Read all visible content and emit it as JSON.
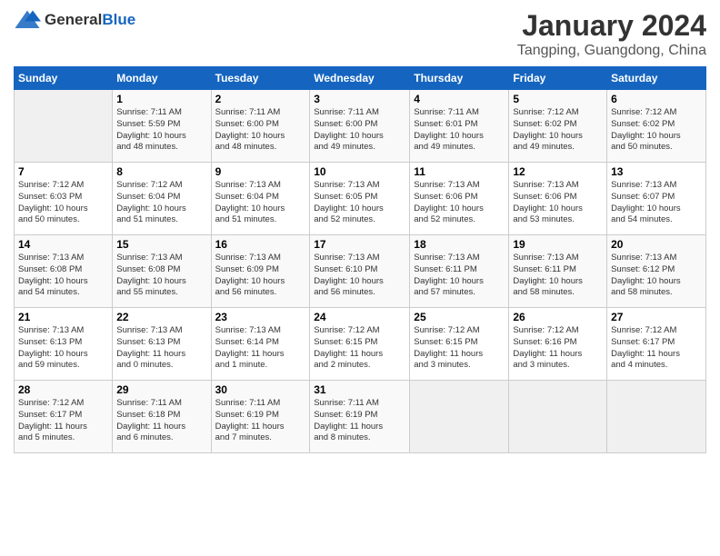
{
  "header": {
    "logo_general": "General",
    "logo_blue": "Blue",
    "main_title": "January 2024",
    "subtitle": "Tangping, Guangdong, China"
  },
  "weekdays": [
    "Sunday",
    "Monday",
    "Tuesday",
    "Wednesday",
    "Thursday",
    "Friday",
    "Saturday"
  ],
  "weeks": [
    [
      {
        "day": "",
        "info": ""
      },
      {
        "day": "1",
        "info": "Sunrise: 7:11 AM\nSunset: 5:59 PM\nDaylight: 10 hours\nand 48 minutes."
      },
      {
        "day": "2",
        "info": "Sunrise: 7:11 AM\nSunset: 6:00 PM\nDaylight: 10 hours\nand 48 minutes."
      },
      {
        "day": "3",
        "info": "Sunrise: 7:11 AM\nSunset: 6:00 PM\nDaylight: 10 hours\nand 49 minutes."
      },
      {
        "day": "4",
        "info": "Sunrise: 7:11 AM\nSunset: 6:01 PM\nDaylight: 10 hours\nand 49 minutes."
      },
      {
        "day": "5",
        "info": "Sunrise: 7:12 AM\nSunset: 6:02 PM\nDaylight: 10 hours\nand 49 minutes."
      },
      {
        "day": "6",
        "info": "Sunrise: 7:12 AM\nSunset: 6:02 PM\nDaylight: 10 hours\nand 50 minutes."
      }
    ],
    [
      {
        "day": "7",
        "info": "Sunrise: 7:12 AM\nSunset: 6:03 PM\nDaylight: 10 hours\nand 50 minutes."
      },
      {
        "day": "8",
        "info": "Sunrise: 7:12 AM\nSunset: 6:04 PM\nDaylight: 10 hours\nand 51 minutes."
      },
      {
        "day": "9",
        "info": "Sunrise: 7:13 AM\nSunset: 6:04 PM\nDaylight: 10 hours\nand 51 minutes."
      },
      {
        "day": "10",
        "info": "Sunrise: 7:13 AM\nSunset: 6:05 PM\nDaylight: 10 hours\nand 52 minutes."
      },
      {
        "day": "11",
        "info": "Sunrise: 7:13 AM\nSunset: 6:06 PM\nDaylight: 10 hours\nand 52 minutes."
      },
      {
        "day": "12",
        "info": "Sunrise: 7:13 AM\nSunset: 6:06 PM\nDaylight: 10 hours\nand 53 minutes."
      },
      {
        "day": "13",
        "info": "Sunrise: 7:13 AM\nSunset: 6:07 PM\nDaylight: 10 hours\nand 54 minutes."
      }
    ],
    [
      {
        "day": "14",
        "info": "Sunrise: 7:13 AM\nSunset: 6:08 PM\nDaylight: 10 hours\nand 54 minutes."
      },
      {
        "day": "15",
        "info": "Sunrise: 7:13 AM\nSunset: 6:08 PM\nDaylight: 10 hours\nand 55 minutes."
      },
      {
        "day": "16",
        "info": "Sunrise: 7:13 AM\nSunset: 6:09 PM\nDaylight: 10 hours\nand 56 minutes."
      },
      {
        "day": "17",
        "info": "Sunrise: 7:13 AM\nSunset: 6:10 PM\nDaylight: 10 hours\nand 56 minutes."
      },
      {
        "day": "18",
        "info": "Sunrise: 7:13 AM\nSunset: 6:11 PM\nDaylight: 10 hours\nand 57 minutes."
      },
      {
        "day": "19",
        "info": "Sunrise: 7:13 AM\nSunset: 6:11 PM\nDaylight: 10 hours\nand 58 minutes."
      },
      {
        "day": "20",
        "info": "Sunrise: 7:13 AM\nSunset: 6:12 PM\nDaylight: 10 hours\nand 58 minutes."
      }
    ],
    [
      {
        "day": "21",
        "info": "Sunrise: 7:13 AM\nSunset: 6:13 PM\nDaylight: 10 hours\nand 59 minutes."
      },
      {
        "day": "22",
        "info": "Sunrise: 7:13 AM\nSunset: 6:13 PM\nDaylight: 11 hours\nand 0 minutes."
      },
      {
        "day": "23",
        "info": "Sunrise: 7:13 AM\nSunset: 6:14 PM\nDaylight: 11 hours\nand 1 minute."
      },
      {
        "day": "24",
        "info": "Sunrise: 7:12 AM\nSunset: 6:15 PM\nDaylight: 11 hours\nand 2 minutes."
      },
      {
        "day": "25",
        "info": "Sunrise: 7:12 AM\nSunset: 6:15 PM\nDaylight: 11 hours\nand 3 minutes."
      },
      {
        "day": "26",
        "info": "Sunrise: 7:12 AM\nSunset: 6:16 PM\nDaylight: 11 hours\nand 3 minutes."
      },
      {
        "day": "27",
        "info": "Sunrise: 7:12 AM\nSunset: 6:17 PM\nDaylight: 11 hours\nand 4 minutes."
      }
    ],
    [
      {
        "day": "28",
        "info": "Sunrise: 7:12 AM\nSunset: 6:17 PM\nDaylight: 11 hours\nand 5 minutes."
      },
      {
        "day": "29",
        "info": "Sunrise: 7:11 AM\nSunset: 6:18 PM\nDaylight: 11 hours\nand 6 minutes."
      },
      {
        "day": "30",
        "info": "Sunrise: 7:11 AM\nSunset: 6:19 PM\nDaylight: 11 hours\nand 7 minutes."
      },
      {
        "day": "31",
        "info": "Sunrise: 7:11 AM\nSunset: 6:19 PM\nDaylight: 11 hours\nand 8 minutes."
      },
      {
        "day": "",
        "info": ""
      },
      {
        "day": "",
        "info": ""
      },
      {
        "day": "",
        "info": ""
      }
    ]
  ]
}
